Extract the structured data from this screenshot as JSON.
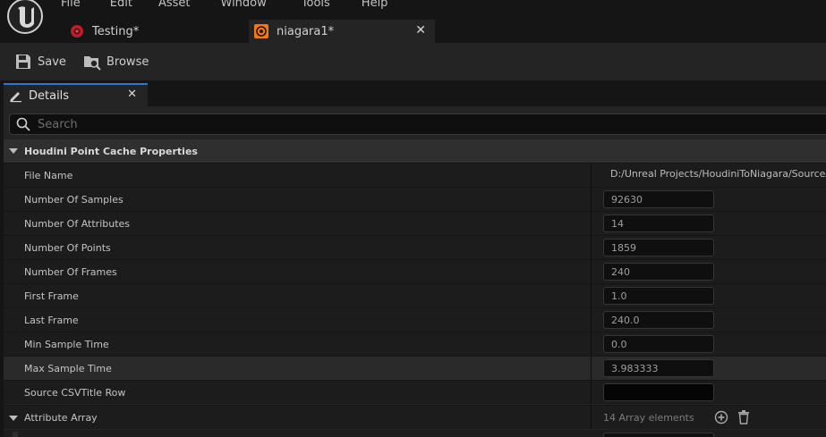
{
  "menu": {
    "items": [
      "File",
      "Edit",
      "Asset",
      "Window",
      "Tools",
      "Help"
    ]
  },
  "tabs": [
    {
      "label": "Testing*",
      "icon": "niagara-system-icon"
    },
    {
      "label": "niagara1*",
      "icon": "houdini-point-cache-icon"
    }
  ],
  "toolbar": {
    "save_label": "Save",
    "browse_label": "Browse"
  },
  "details": {
    "tab_label": "Details",
    "search_placeholder": "Search",
    "category_label": "Houdini Point Cache Properties",
    "properties": [
      {
        "name": "File Name",
        "value": "D:/Unreal Projects/HoudiniToNiagara/SourceAs"
      },
      {
        "name": "Number Of Samples",
        "value": "92630"
      },
      {
        "name": "Number Of Attributes",
        "value": "14"
      },
      {
        "name": "Number Of Points",
        "value": "1859"
      },
      {
        "name": "Number Of Frames",
        "value": "240"
      },
      {
        "name": "First Frame",
        "value": "1.0"
      },
      {
        "name": "Last Frame",
        "value": "240.0"
      },
      {
        "name": "Min Sample Time",
        "value": "0.0"
      },
      {
        "name": "Max Sample Time",
        "value": "3.983333"
      },
      {
        "name": "Source CSVTitle Row",
        "value": ""
      }
    ],
    "array": {
      "name": "Attribute Array",
      "count_label": "14 Array elements"
    }
  },
  "colors": {
    "accent_blue": "#2b78d0",
    "panel_bg": "#242424",
    "row_bg": "#1c1c1c",
    "window_bg": "#151515"
  }
}
